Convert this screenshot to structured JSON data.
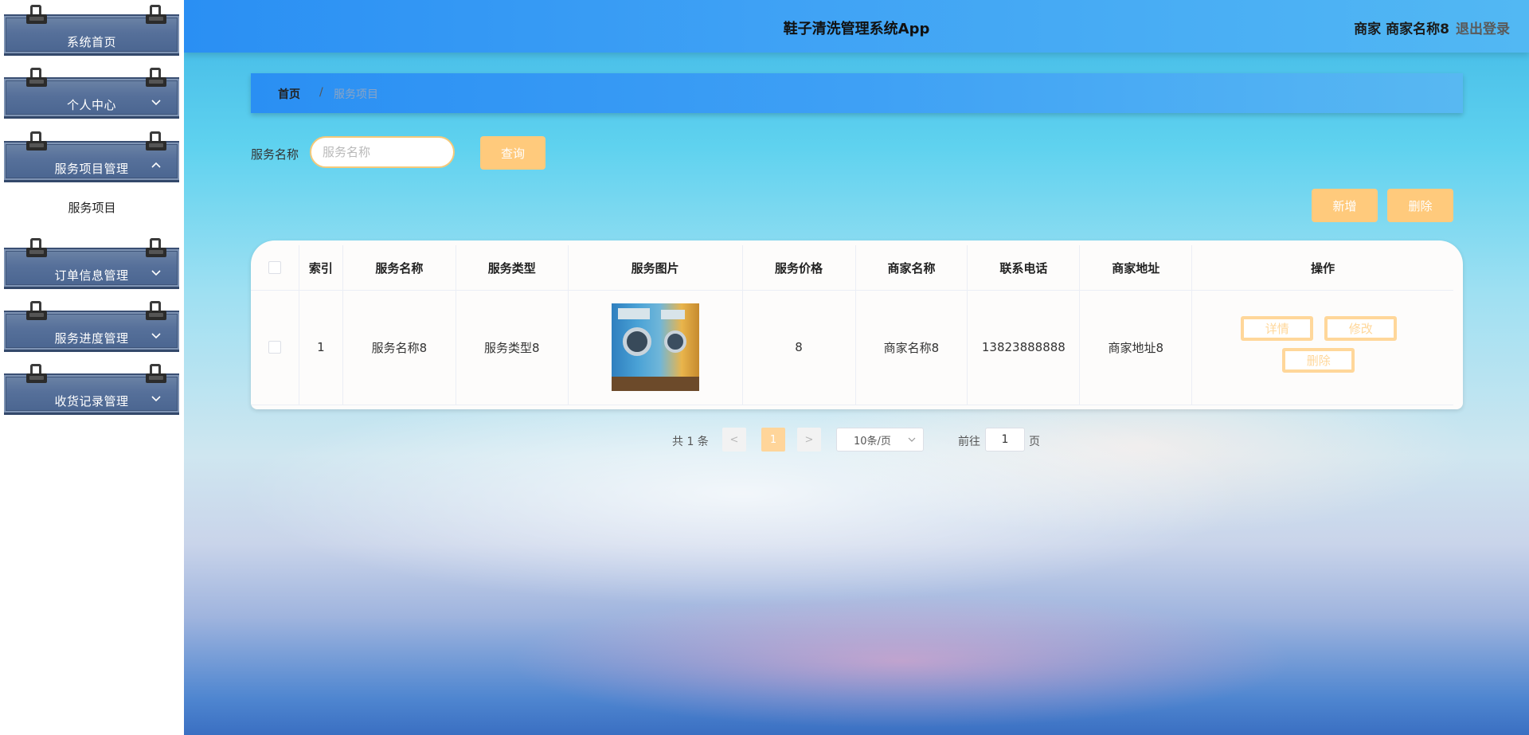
{
  "sidebar": {
    "items": [
      {
        "label": "系统首页",
        "has_chevron": false,
        "expanded": false
      },
      {
        "label": "个人中心",
        "has_chevron": true,
        "expanded": false
      },
      {
        "label": "服务项目管理",
        "has_chevron": true,
        "expanded": true
      },
      {
        "label": "订单信息管理",
        "has_chevron": true,
        "expanded": false
      },
      {
        "label": "服务进度管理",
        "has_chevron": true,
        "expanded": false
      },
      {
        "label": "收货记录管理",
        "has_chevron": true,
        "expanded": false
      }
    ],
    "sub_item": "服务项目"
  },
  "header": {
    "app_title": "鞋子清洗管理系统App",
    "role": "商家",
    "username": "商家名称8",
    "logout": "退出登录"
  },
  "breadcrumb": {
    "home": "首页",
    "separator": "/",
    "current": "服务项目"
  },
  "search": {
    "label": "服务名称",
    "placeholder": "服务名称",
    "value": "",
    "query_button": "查询"
  },
  "actions": {
    "add": "新增",
    "delete": "删除"
  },
  "table": {
    "columns": [
      "索引",
      "服务名称",
      "服务类型",
      "服务图片",
      "服务价格",
      "商家名称",
      "联系电话",
      "商家地址",
      "操作"
    ],
    "rows": [
      {
        "index": "1",
        "service_name": "服务名称8",
        "service_type": "服务类型8",
        "image": "washing-machine-photo",
        "price": "8",
        "shop_name": "商家名称8",
        "phone": "13823888888",
        "address": "商家地址8",
        "ops": {
          "detail": "详情",
          "edit": "修改",
          "delete": "删除"
        }
      }
    ]
  },
  "pagination": {
    "total": "共 1 条",
    "prev": "<",
    "current_page": "1",
    "next": ">",
    "page_size": "10条/页",
    "goto_label": "前往",
    "goto_value": "1",
    "page_label": "页"
  },
  "colors": {
    "topbar": "#2a8ff3",
    "accent_orange": "#ffca7c",
    "menu_block": "#56709a"
  }
}
